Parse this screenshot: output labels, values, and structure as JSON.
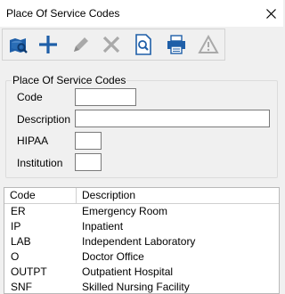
{
  "window": {
    "title": "Place Of Service Codes"
  },
  "toolbar": {
    "buttons": [
      {
        "name": "search-database",
        "icon": "search-database-icon",
        "enabled": true
      },
      {
        "name": "add",
        "icon": "plus-icon",
        "enabled": true
      },
      {
        "name": "edit",
        "icon": "pencil-icon",
        "enabled": false
      },
      {
        "name": "delete",
        "icon": "x-icon",
        "enabled": false
      },
      {
        "name": "preview",
        "icon": "magnifier-page-icon",
        "enabled": true
      },
      {
        "name": "print",
        "icon": "printer-icon",
        "enabled": true
      },
      {
        "name": "warning",
        "icon": "warning-triangle-icon",
        "enabled": false
      }
    ]
  },
  "form": {
    "group_title": "Place Of Service Codes",
    "code_label": "Code",
    "code_value": "",
    "description_label": "Description",
    "description_value": "",
    "hipaa_label": "HIPAA",
    "hipaa_value": "",
    "institution_label": "Institution",
    "institution_value": ""
  },
  "grid": {
    "columns": [
      "Code",
      "Description"
    ],
    "rows": [
      {
        "code": "ER",
        "description": "Emergency Room"
      },
      {
        "code": "IP",
        "description": "Inpatient"
      },
      {
        "code": "LAB",
        "description": "Independent Laboratory"
      },
      {
        "code": "O",
        "description": "Doctor Office"
      },
      {
        "code": "OUTPT",
        "description": "Outpatient Hospital"
      },
      {
        "code": "SNF",
        "description": "Skilled Nursing Facility"
      }
    ]
  },
  "colors": {
    "accent": "#1f5fa8",
    "disabled": "#a0a0a0"
  }
}
